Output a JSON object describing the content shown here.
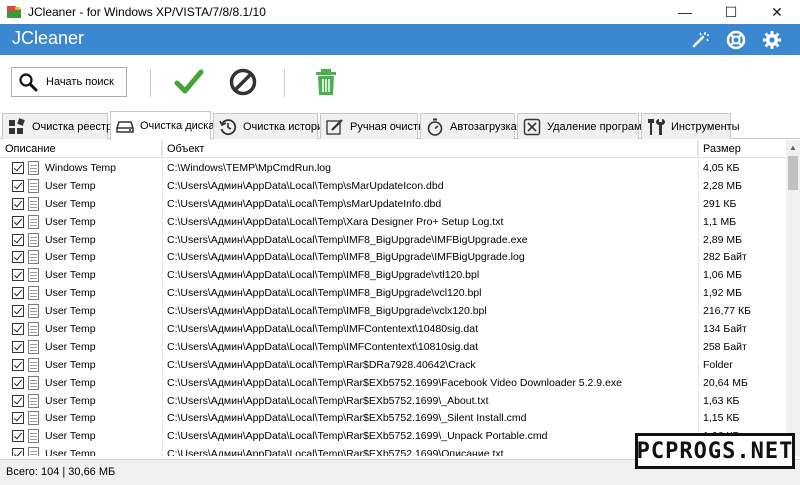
{
  "window": {
    "title": "JCleaner - for Windows XP/VISTA/7/8/8.1/10",
    "minimize": "—",
    "maximize": "☐",
    "close": "✕"
  },
  "header": {
    "brand": "JCleaner",
    "icons": [
      "magic-wand-icon",
      "help-lifebuoy-icon",
      "gear-icon"
    ]
  },
  "toolbar": {
    "search_label": "Начать поиск",
    "icons": [
      "search-icon",
      "checkmark-icon",
      "cancel-icon",
      "trash-icon"
    ]
  },
  "tabs": [
    {
      "label": "Очистка реестра",
      "icon": "registry-icon",
      "active": false
    },
    {
      "label": "Очистка диска",
      "icon": "disk-icon",
      "active": true
    },
    {
      "label": "Очистка истории",
      "icon": "history-icon",
      "active": false
    },
    {
      "label": "Ручная очистка",
      "icon": "pencil-icon",
      "active": false
    },
    {
      "label": "Автозагрузка",
      "icon": "stopwatch-icon",
      "active": false
    },
    {
      "label": "Удаление программ",
      "icon": "uninstall-icon",
      "active": false
    },
    {
      "label": "Инструменты",
      "icon": "tools-icon",
      "active": false
    }
  ],
  "table": {
    "columns": [
      "Описание",
      "Объект",
      "Размер"
    ],
    "rows": [
      {
        "desc": "Windows Temp",
        "obj": "C:\\Windows\\TEMP\\MpCmdRun.log",
        "size": "4,05 КБ"
      },
      {
        "desc": "User Temp",
        "obj": "C:\\Users\\Админ\\AppData\\Local\\Temp\\sMarUpdateIcon.dbd",
        "size": "2,28 МБ"
      },
      {
        "desc": "User Temp",
        "obj": "C:\\Users\\Админ\\AppData\\Local\\Temp\\sMarUpdateInfo.dbd",
        "size": "291 КБ"
      },
      {
        "desc": "User Temp",
        "obj": "C:\\Users\\Админ\\AppData\\Local\\Temp\\Xara Designer Pro+ Setup Log.txt",
        "size": "1,1 МБ"
      },
      {
        "desc": "User Temp",
        "obj": "C:\\Users\\Админ\\AppData\\Local\\Temp\\IMF8_BigUpgrade\\IMFBigUpgrade.exe",
        "size": "2,89 МБ"
      },
      {
        "desc": "User Temp",
        "obj": "C:\\Users\\Админ\\AppData\\Local\\Temp\\IMF8_BigUpgrade\\IMFBigUpgrade.log",
        "size": "282 Байт"
      },
      {
        "desc": "User Temp",
        "obj": "C:\\Users\\Админ\\AppData\\Local\\Temp\\IMF8_BigUpgrade\\vtl120.bpl",
        "size": "1,06 МБ"
      },
      {
        "desc": "User Temp",
        "obj": "C:\\Users\\Админ\\AppData\\Local\\Temp\\IMF8_BigUpgrade\\vcl120.bpl",
        "size": "1,92 МБ"
      },
      {
        "desc": "User Temp",
        "obj": "C:\\Users\\Админ\\AppData\\Local\\Temp\\IMF8_BigUpgrade\\vclx120.bpl",
        "size": "216,77 КБ"
      },
      {
        "desc": "User Temp",
        "obj": "C:\\Users\\Админ\\AppData\\Local\\Temp\\IMFContentext\\10480sig.dat",
        "size": "134 Байт"
      },
      {
        "desc": "User Temp",
        "obj": "C:\\Users\\Админ\\AppData\\Local\\Temp\\IMFContentext\\10810sig.dat",
        "size": "258 Байт"
      },
      {
        "desc": "User Temp",
        "obj": "C:\\Users\\Админ\\AppData\\Local\\Temp\\Rar$DRa7928.40642\\Crack",
        "size": "Folder"
      },
      {
        "desc": "User Temp",
        "obj": "C:\\Users\\Админ\\AppData\\Local\\Temp\\Rar$EXb5752.1699\\Facebook Video Downloader 5.2.9.exe",
        "size": "20,64 МБ"
      },
      {
        "desc": "User Temp",
        "obj": "C:\\Users\\Админ\\AppData\\Local\\Temp\\Rar$EXb5752.1699\\_About.txt",
        "size": "1,63 КБ"
      },
      {
        "desc": "User Temp",
        "obj": "C:\\Users\\Админ\\AppData\\Local\\Temp\\Rar$EXb5752.1699\\_Silent Install.cmd",
        "size": "1,15 КБ"
      },
      {
        "desc": "User Temp",
        "obj": "C:\\Users\\Админ\\AppData\\Local\\Temp\\Rar$EXb5752.1699\\_Unpack Portable.cmd",
        "size": "1,06 КБ"
      },
      {
        "desc": "User Temp",
        "obj": "C:\\Users\\Админ\\AppData\\Local\\Temp\\Rar$EXb5752.1699\\Описание.txt",
        "size": ""
      }
    ]
  },
  "status": {
    "text": "Всего: 104 | 30,66 МБ"
  },
  "watermark": "PCPROGS.NET",
  "colors": {
    "header_blue": "#3b87d0",
    "check_green": "#3fa535",
    "cancel_dark": "#333333",
    "trash_green": "#4caf50"
  }
}
